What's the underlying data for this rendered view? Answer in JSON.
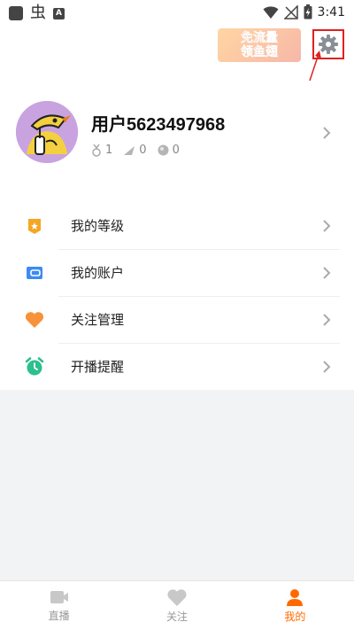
{
  "status_bar": {
    "time": "3:41"
  },
  "promo": {
    "line1": "免流量",
    "line2": "领鱼翅"
  },
  "profile": {
    "username": "用户5623497968",
    "stats": [
      {
        "icon": "medal-icon",
        "value": "1"
      },
      {
        "icon": "fin-icon",
        "value": "0"
      },
      {
        "icon": "coin-icon",
        "value": "0"
      }
    ]
  },
  "menu": {
    "items": [
      {
        "label": "我的等级",
        "icon": "level-badge-icon",
        "color": "#f5a623"
      },
      {
        "label": "我的账户",
        "icon": "wallet-icon",
        "color": "#3d8bf2"
      },
      {
        "label": "关注管理",
        "icon": "heart-icon",
        "color": "#f7923a"
      },
      {
        "label": "开播提醒",
        "icon": "alarm-clock-icon",
        "color": "#2dbf8c"
      }
    ]
  },
  "bottom_nav": {
    "tabs": [
      {
        "label": "直播",
        "icon": "video-camera-icon",
        "active": false
      },
      {
        "label": "关注",
        "icon": "heart-icon",
        "active": false
      },
      {
        "label": "我的",
        "icon": "person-icon",
        "active": true
      }
    ]
  },
  "colors": {
    "accent": "#ff6a00",
    "annotation": "#e02020"
  }
}
